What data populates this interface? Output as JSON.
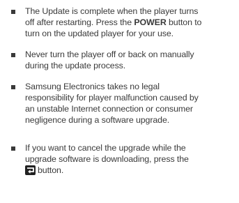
{
  "notes": [
    {
      "lines": [
        "The Update is complete when the player turns",
        "off after restarting. Press the ",
        "POWER",
        " button to",
        "turn on the updated player for your use."
      ]
    },
    {
      "lines": [
        "Never turn the player off or back on manually",
        "during the update process."
      ]
    },
    {
      "lines": [
        "Samsung Electronics takes no legal",
        "responsibility for player malfunction caused by",
        "an unstable Internet connection or consumer",
        "negligence during a software upgrade."
      ]
    },
    {
      "lines": [
        "If you want to cancel the upgrade while the",
        "upgrade software is downloading, press the",
        "button."
      ]
    }
  ],
  "icons": {
    "bullet": "square-bullet-icon",
    "return": "return-button-icon"
  },
  "colors": {
    "text": "#3a3a3a",
    "icon": "#222222"
  }
}
